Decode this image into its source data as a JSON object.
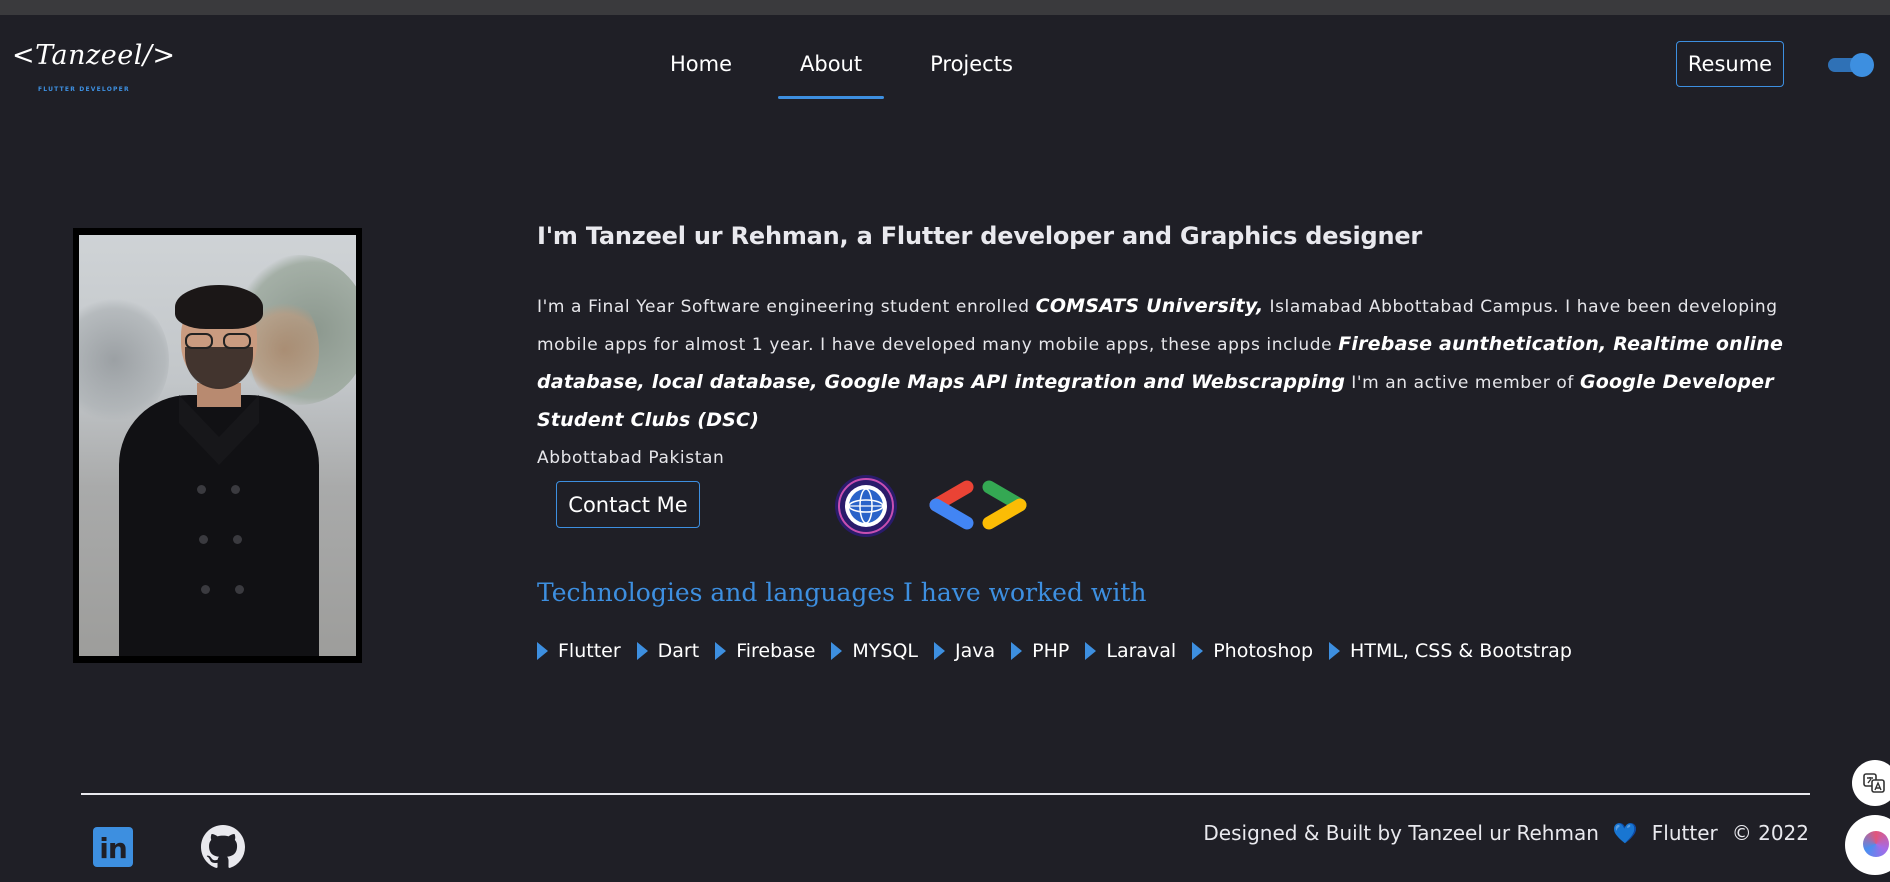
{
  "header": {
    "logo_text": "<Tanzeel/>",
    "logo_subtitle": "FLUTTER DEVELOPER",
    "nav": [
      {
        "label": "Home",
        "active": false
      },
      {
        "label": "About",
        "active": true
      },
      {
        "label": "Projects",
        "active": false
      }
    ],
    "resume_label": "Resume",
    "theme_toggle_on": true
  },
  "about": {
    "headline": "I'm Tanzeel ur Rehman, a Flutter developer and Graphics designer",
    "bio": {
      "p1": "I'm a Final Year Software engineering student enrolled ",
      "b1": "COMSATS University,",
      "p2": " Islamabad Abbottabad Campus.  I have been developing mobile apps for almost 1 year. I have developed many mobile apps, these apps include ",
      "b2": "Firebase aunthetication, Realtime online database, local database, Google Maps API integration and Webscrapping",
      "p3": " I'm an active member of ",
      "b3": "Google Developer Student Clubs (DSC)",
      "p4": "Abbottabad Pakistan"
    },
    "contact_label": "Contact Me",
    "comsats_logo_text": "COMSATS UNIVERSITY ISLAMABAD",
    "tech_heading": "Technologies and languages I have worked with",
    "technologies": [
      "Flutter",
      "Dart",
      "Firebase",
      "MYSQL",
      "Java",
      "PHP",
      "Laraval",
      "Photoshop",
      "HTML, CSS & Bootstrap"
    ]
  },
  "footer": {
    "linkedin_text": "in",
    "credit_text": "Designed & Built by Tanzeel ur Rehman",
    "heart": "💙",
    "framework": "Flutter",
    "copyright": "© 2022"
  },
  "icons": {
    "linkedin": "linkedin-icon",
    "github": "github-icon",
    "translate": "translate-icon",
    "assistant": "brain-icon",
    "accent_color": "#3d8fe0",
    "background_color": "#1f1f26"
  }
}
